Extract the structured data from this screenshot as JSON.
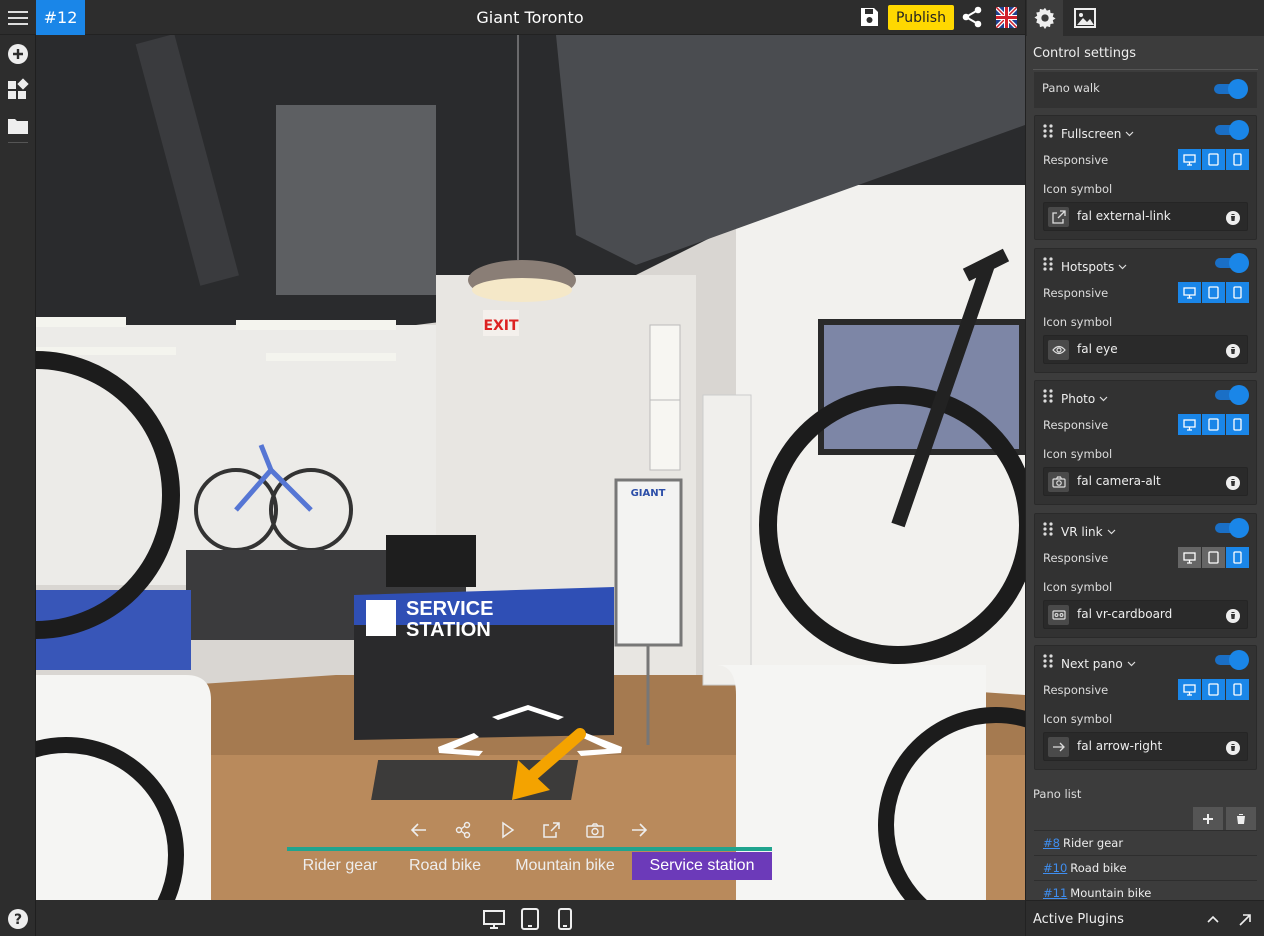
{
  "header": {
    "tour_id": "#12",
    "title": "Giant Toronto",
    "publish_label": "Publish"
  },
  "panel": {
    "heading": "Control settings",
    "pano_walk_label": "Pano walk",
    "responsive_label": "Responsive",
    "icon_symbol_label": "Icon symbol",
    "controls": [
      {
        "name": "Fullscreen",
        "icon": "fal external-link",
        "responsive": [
          true,
          true,
          true
        ]
      },
      {
        "name": "Hotspots",
        "icon": "fal eye",
        "responsive": [
          true,
          true,
          true
        ]
      },
      {
        "name": "Photo",
        "icon": "fal camera-alt",
        "responsive": [
          true,
          true,
          true
        ]
      },
      {
        "name": "VR link",
        "icon": "fal vr-cardboard",
        "responsive": [
          false,
          false,
          true
        ]
      },
      {
        "name": "Next pano",
        "icon": "fal arrow-right",
        "responsive": [
          true,
          true,
          true
        ]
      }
    ],
    "pano_list_label": "Pano list",
    "pano_list": [
      {
        "num": "#8",
        "name": "Rider gear"
      },
      {
        "num": "#10",
        "name": "Road bike"
      },
      {
        "num": "#11",
        "name": "Mountain bike"
      }
    ],
    "active_plugins_label": "Active Plugins"
  },
  "viewer": {
    "scene_signage": {
      "counter_sign_line1": "SERVICE",
      "counter_sign_line2": "STATION",
      "exit_sign": "EXIT",
      "brand": "GIANT"
    },
    "pano_titles": [
      "Rider gear",
      "Road bike",
      "Mountain bike",
      "Service station"
    ],
    "active_pano_index": 3
  },
  "colors": {
    "accent_blue": "#1a86e8",
    "publish_yellow": "#ffd800",
    "active_pano_purple": "#6c3ab9",
    "title_bar_teal": "#20a48e",
    "hotspot_arrow_orange": "#f4a300"
  }
}
